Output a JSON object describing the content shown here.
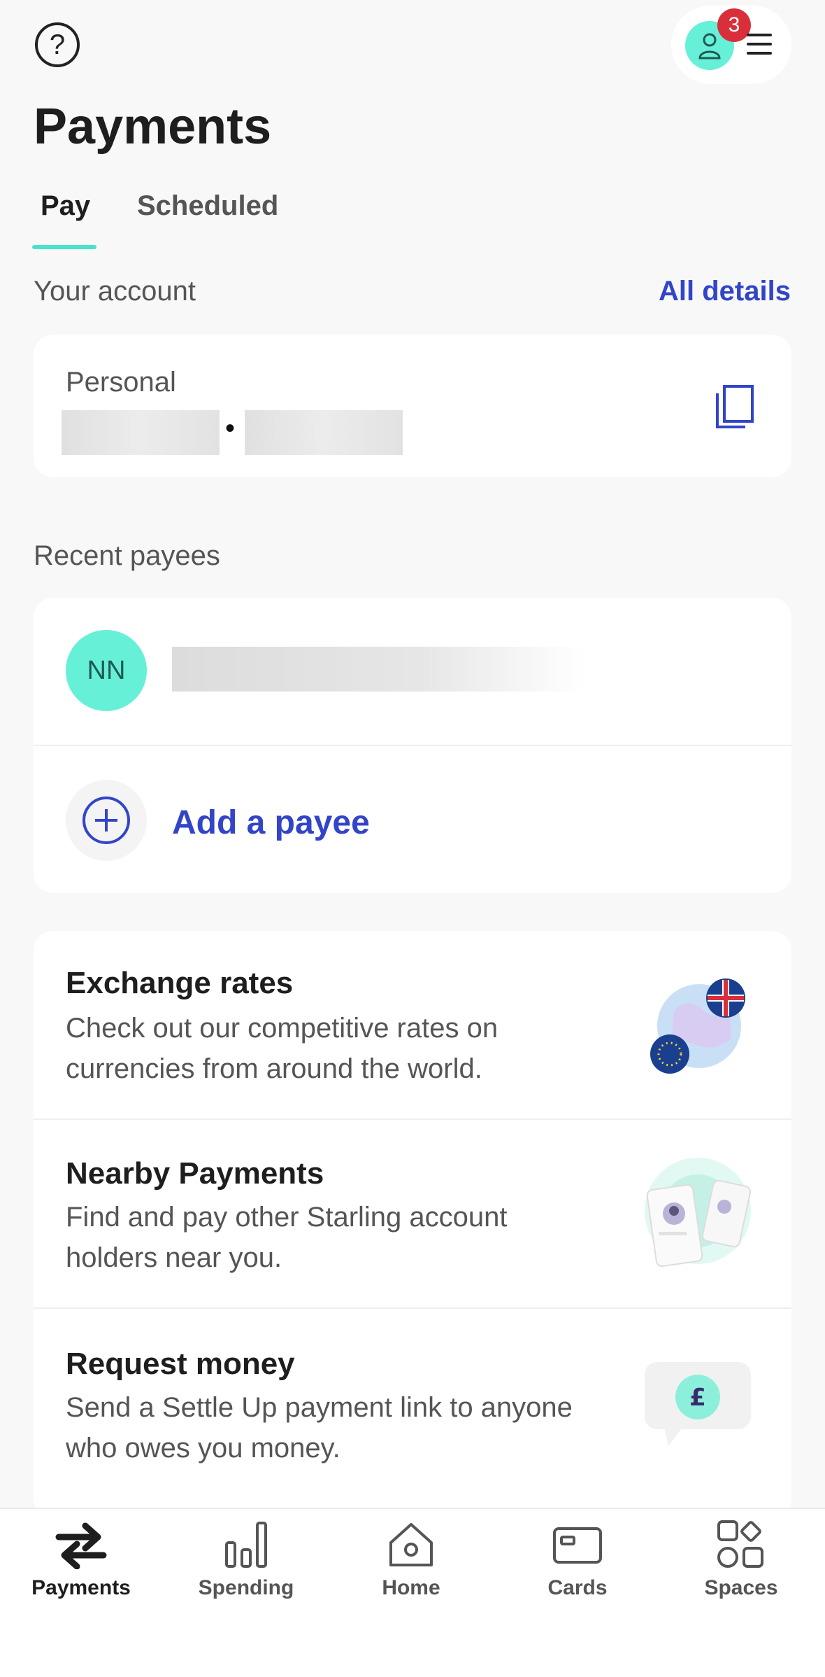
{
  "header": {
    "help_icon_glyph": "?",
    "notification_count": "3",
    "title": "Payments"
  },
  "tabs": [
    {
      "label": "Pay",
      "active": true
    },
    {
      "label": "Scheduled",
      "active": false
    }
  ],
  "account": {
    "section_label": "Your account",
    "all_details_link": "All details",
    "name": "Personal",
    "separator": "•"
  },
  "recent_payees": {
    "section_label": "Recent payees",
    "payees": [
      {
        "initials": "NN"
      }
    ],
    "add_payee_label": "Add a payee"
  },
  "promos": [
    {
      "title": "Exchange rates",
      "description": "Check out our competitive rates on currencies from around the world.",
      "icon": "globe-flags-icon"
    },
    {
      "title": "Nearby Payments",
      "description": "Find and pay other Starling account holders near you.",
      "icon": "nearby-phones-icon"
    },
    {
      "title": "Request money",
      "description": "Send a Settle Up payment link to anyone who owes you money.",
      "icon": "pound-bubble-icon"
    }
  ],
  "bottom_nav": [
    {
      "label": "Payments",
      "icon": "payments-arrows-icon",
      "active": true
    },
    {
      "label": "Spending",
      "icon": "bar-chart-icon",
      "active": false
    },
    {
      "label": "Home",
      "icon": "home-icon",
      "active": false
    },
    {
      "label": "Cards",
      "icon": "card-icon",
      "active": false
    },
    {
      "label": "Spaces",
      "icon": "spaces-icon",
      "active": false
    }
  ],
  "colors": {
    "accent_teal": "#48e3cc",
    "avatar_teal": "#66f0d8",
    "link_blue": "#3245c8",
    "badge_red": "#d92f3a",
    "background": "#f8f8f8"
  }
}
